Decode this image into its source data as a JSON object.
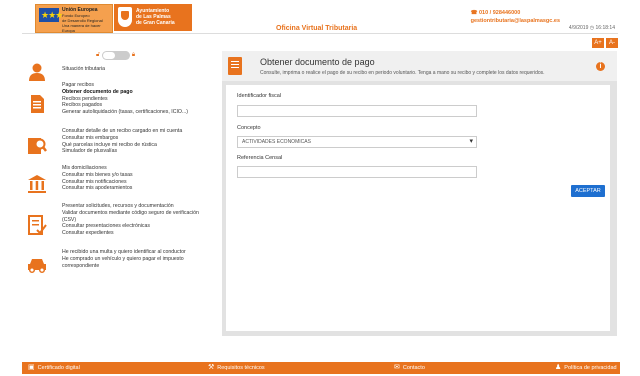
{
  "header": {
    "eu_logo": {
      "title": "Unión Europea",
      "lines": [
        "Fondo Europeo",
        "de Desarrollo Regional",
        "Una manera de hacer Europa"
      ]
    },
    "ayto_logo": {
      "lines": [
        "Ayuntamiento",
        "de Las Palmas",
        "de Gran Canaria"
      ]
    },
    "page_title": "Oficina Virtual Tributaria",
    "phone": "010 / 928446000",
    "email": "gestiontributaria@laspalmasgc.es",
    "date": "4/9/2019",
    "time": "16:18:14",
    "icon_buttons": [
      "A+",
      "A-"
    ]
  },
  "sidebar": {
    "toggle": {
      "state": "off"
    },
    "groups": [
      {
        "icon": "user-icon",
        "items": [
          {
            "label": "Situación tributaria"
          }
        ]
      },
      {
        "icon": "document-icon",
        "items": [
          {
            "label": "Pagar recibos"
          },
          {
            "label": "Obtener documento de pago",
            "active": true
          },
          {
            "label": "Recibos pendientes"
          },
          {
            "label": "Recibos pagados"
          },
          {
            "label": "Generar autoliquidación (tasas, certificaciones, ICIO...)"
          }
        ]
      },
      {
        "icon": "search-document-icon",
        "items": [
          {
            "label": "Consultar detalle de un recibo cargado en mi cuenta"
          },
          {
            "label": "Consultar mis embargos"
          },
          {
            "label": "Qué parcelas incluye mi recibo de rústica"
          },
          {
            "label": "Simulador de plusvalías"
          }
        ]
      },
      {
        "icon": "bank-icon",
        "items": [
          {
            "label": "Mis domiciliaciones"
          },
          {
            "label": "Consultar mis bienes y/o tasas"
          },
          {
            "label": "Consultar mis notificaciones"
          },
          {
            "label": "Consultar mis apoderamientos"
          }
        ]
      },
      {
        "icon": "form-check-icon",
        "items": [
          {
            "label": "Presentar solicitudes, recursos y documentación"
          },
          {
            "label": "Validar documentos mediante código seguro de verificación"
          },
          {
            "label": "(CSV)"
          },
          {
            "label": "Consultar presentaciones electrónicas"
          },
          {
            "label": "Consultar expedientes"
          }
        ]
      },
      {
        "icon": "car-icon",
        "items": [
          {
            "label": "He recibido una multa y quiero identificar al conductor"
          },
          {
            "label": "He comprado un vehículo y quiero pagar el impuesto"
          },
          {
            "label": "correspondiente"
          }
        ]
      }
    ]
  },
  "panel": {
    "title": "Obtener documento de pago",
    "subtitle": "Consulte, imprima o realice el pago de su recibo en periodo voluntario. Tenga a mano su recibo y complete los datos requeridos.",
    "fields": {
      "fiscal_label": "Identificador fiscal",
      "fiscal_value": "",
      "concept_label": "Concepto",
      "concept_value": "ACTIVIDADES ECONOMICAS",
      "census_label": "Referencia Censal",
      "census_value": ""
    },
    "accept_label": "ACEPTAR"
  },
  "footer": {
    "items": [
      {
        "icon": "certificate-icon",
        "label": "Certificado digital"
      },
      {
        "icon": "wrench-icon",
        "label": "Requisitos técnicos"
      },
      {
        "icon": "contact-icon",
        "label": "Contacto"
      },
      {
        "icon": "privacy-icon",
        "label": "Política de privacidad"
      }
    ]
  },
  "colors": {
    "accent": "#e8731e",
    "button": "#1e6fd0",
    "panel_bg": "#e2e2e2"
  }
}
